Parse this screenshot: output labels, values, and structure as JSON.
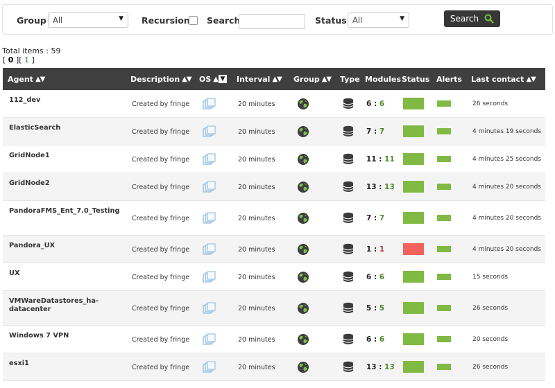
{
  "filters": {
    "group_label": "Group",
    "group_value": "All",
    "recursion_label": "Recursion",
    "search_label": "Search",
    "search_value": "",
    "status_label": "Status",
    "status_value": "All",
    "search_button": "Search"
  },
  "total_items": "Total items : 59",
  "pager": {
    "open": "[ ",
    "current": "0",
    "sep": " ][ ",
    "next": "1",
    "close": " ]"
  },
  "columns": {
    "agent": "Agent",
    "description": "Description",
    "os": "OS",
    "interval": "Interval",
    "group": "Group",
    "type": "Type",
    "modules": "Modules",
    "status": "Status",
    "alerts": "Alerts",
    "last_contact": "Last contact"
  },
  "colors": {
    "ok": "#80ba45",
    "critical": "#f2615b",
    "header": "#3f3f3f"
  },
  "rows": [
    {
      "agent": "112_dev",
      "description": "Created by fringe",
      "interval": "20 minutes",
      "modules_total": "6",
      "modules_ok": "6",
      "status": "ok",
      "last_contact": "26 seconds"
    },
    {
      "agent": "ElasticSearch",
      "description": "Created by fringe",
      "interval": "20 minutes",
      "modules_total": "7",
      "modules_ok": "7",
      "status": "ok",
      "last_contact": "4 minutes 19 seconds"
    },
    {
      "agent": "GridNode1",
      "description": "Created by fringe",
      "interval": "20 minutes",
      "modules_total": "11",
      "modules_ok": "11",
      "status": "ok",
      "last_contact": "4 minutes 25 seconds"
    },
    {
      "agent": "GridNode2",
      "description": "Created by fringe",
      "interval": "20 minutes",
      "modules_total": "13",
      "modules_ok": "13",
      "status": "ok",
      "last_contact": "4 minutes 20 seconds"
    },
    {
      "agent": "PandoraFMS_Ent_7.0_Testing",
      "description": "Created by fringe",
      "interval": "20 minutes",
      "modules_total": "7",
      "modules_ok": "7",
      "status": "ok",
      "last_contact": "4 minutes 20 seconds"
    },
    {
      "agent": "Pandora_UX",
      "description": "Created by fringe",
      "interval": "20 minutes",
      "modules_total": "1",
      "modules_ok": "1",
      "status": "critical",
      "last_contact": "4 minutes 20 seconds"
    },
    {
      "agent": "UX",
      "description": "Created by fringe",
      "interval": "20 minutes",
      "modules_total": "6",
      "modules_ok": "6",
      "status": "ok",
      "last_contact": "15 seconds"
    },
    {
      "agent": "VMWareDatastores_ha-datacenter",
      "description": "Created by fringe",
      "interval": "20 minutes",
      "modules_total": "5",
      "modules_ok": "5",
      "status": "ok",
      "last_contact": "26 seconds"
    },
    {
      "agent": "Windows 7 VPN",
      "description": "Created by fringe",
      "interval": "20 minutes",
      "modules_total": "6",
      "modules_ok": "6",
      "status": "ok",
      "last_contact": "20 seconds"
    },
    {
      "agent": "esxi1",
      "description": "Created by fringe",
      "interval": "20 minutes",
      "modules_total": "13",
      "modules_ok": "13",
      "status": "ok",
      "last_contact": "26 seconds"
    }
  ]
}
